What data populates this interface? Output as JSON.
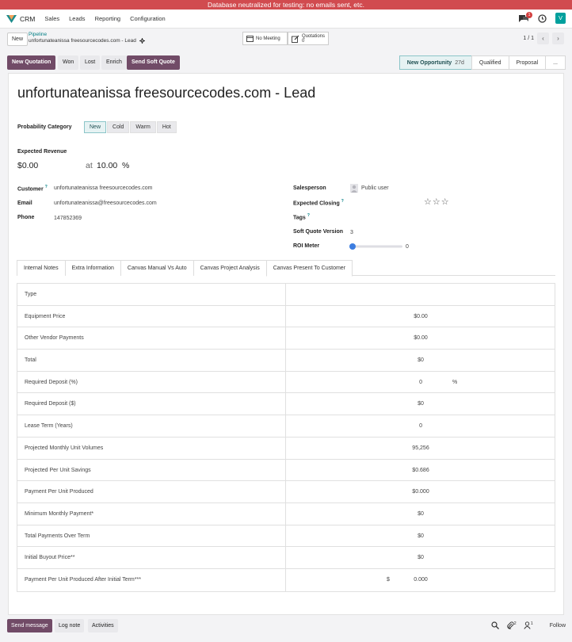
{
  "banner": "Database neutralized for testing: no emails sent, etc.",
  "navbar": {
    "app": "CRM",
    "menu": [
      "Sales",
      "Leads",
      "Reporting",
      "Configuration"
    ],
    "chat_count": "1",
    "avatar_letter": "V"
  },
  "control": {
    "new_label": "New",
    "breadcrumb_parent": "Pipeline",
    "record_title": "unfortunateanissa freesourcecodes.com - Lead",
    "meeting_label": "No Meeting",
    "quotations_label": "Quotations",
    "quotations_count": "0",
    "pager": "1 / 1"
  },
  "actions": {
    "new_quotation": "New Quotation",
    "won": "Won",
    "lost": "Lost",
    "enrich": "Enrich",
    "send_soft_quote": "Send Soft Quote"
  },
  "stages": {
    "current": "New Opportunity",
    "current_days": "27d",
    "others": [
      "Qualified",
      "Proposal",
      "..."
    ]
  },
  "form": {
    "title": "unfortunateanissa freesourcecodes.com - Lead",
    "probability_label": "Probability Category",
    "probability_options": [
      "New",
      "Cold",
      "Warm",
      "Hot"
    ],
    "expected_revenue_label": "Expected Revenue",
    "expected_revenue": "$0.00",
    "at_label": "at",
    "probability": "10.00",
    "percent": "%",
    "customer_label": "Customer",
    "customer": "unfortunateanissa freesourcecodes.com",
    "email_label": "Email",
    "email": "unfortunateanissa@freesourcecodes.com",
    "phone_label": "Phone",
    "phone": "147852369",
    "salesperson_label": "Salesperson",
    "salesperson": "Public user",
    "expected_closing_label": "Expected Closing",
    "tags_label": "Tags",
    "soft_quote_version_label": "Soft Quote Version",
    "soft_quote_version": "3",
    "roi_meter_label": "ROI Meter",
    "roi_meter_value": "0",
    "roi_meter_fraction": 0,
    "help_mark": "?"
  },
  "tabs": [
    "Internal Notes",
    "Extra Information",
    "Canvas Manual Vs Auto",
    "Canvas Project Analysis",
    "Canvas Present To Customer"
  ],
  "table": {
    "rows": [
      {
        "label": "Type",
        "value": ""
      },
      {
        "label": "Equipment Price",
        "value": "$0.00"
      },
      {
        "label": "Other Vendor Payments",
        "value": "$0.00"
      },
      {
        "label": "Total",
        "value": "$0"
      },
      {
        "label": "Required Deposit (%)",
        "value": "0",
        "suffix": "%"
      },
      {
        "label": "Required Deposit ($)",
        "value": "$0"
      },
      {
        "label": "Lease Term (Years)",
        "value": "0"
      },
      {
        "label": "Projected Monthly Unit Volumes",
        "value": "95,256"
      },
      {
        "label": "Projected Per Unit Savings",
        "value": "$0.686"
      },
      {
        "label": "Payment Per Unit Produced",
        "value": "$0.000"
      },
      {
        "label": "Minimum Monthly Payment*",
        "value": "$0"
      },
      {
        "label": "Total Payments Over Term",
        "value": "$0"
      },
      {
        "label": "Initial Buyout Price**",
        "value": "$0"
      },
      {
        "label": "Payment Per Unit Produced After Initial Term***",
        "value": "0.000",
        "prefix": "$"
      }
    ]
  },
  "chatter": {
    "send_message": "Send message",
    "log_note": "Log note",
    "activities": "Activities",
    "attachments_count": "2",
    "followers_count": "1",
    "follow": "Follow"
  }
}
